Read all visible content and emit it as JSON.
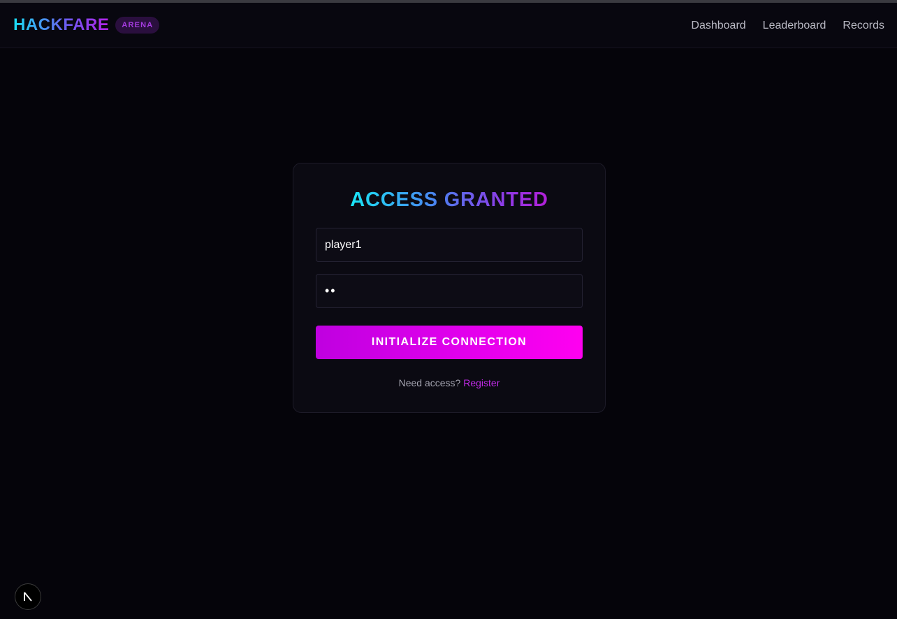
{
  "header": {
    "brand_name": "HACKFARE",
    "brand_badge": "ARENA",
    "nav": [
      {
        "label": "Dashboard"
      },
      {
        "label": "Leaderboard"
      },
      {
        "label": "Records"
      }
    ]
  },
  "login": {
    "title": "ACCESS GRANTED",
    "username_value": "player1",
    "password_value": "••",
    "submit_label": "INITIALIZE CONNECTION",
    "prompt_text": "Need access?",
    "register_link": "Register"
  },
  "dev_indicator": {
    "label": "N",
    "icon": "nextjs-logo-icon"
  },
  "colors": {
    "background": "#05040a",
    "card": "#0b0a12",
    "accent_cyan": "#19e0f5",
    "accent_purple": "#b322e8",
    "button_magenta": "#ff00f0"
  }
}
